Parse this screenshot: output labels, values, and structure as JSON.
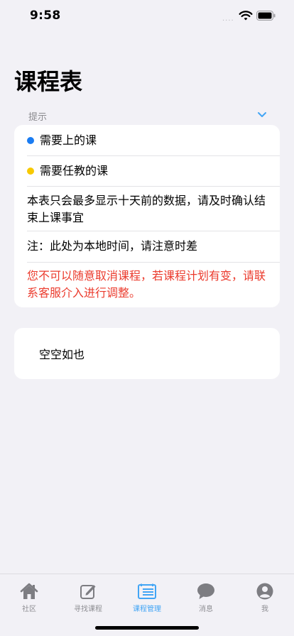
{
  "status_bar": {
    "time": "9:58",
    "signal": "...."
  },
  "page": {
    "title": "课程表"
  },
  "tips": {
    "header": "提示",
    "items": [
      {
        "text": "需要上的课",
        "dot_color": "#1a7cf2"
      },
      {
        "text": "需要任教的课",
        "dot_color": "#f7c900"
      },
      {
        "text": "本表只会最多显示十天前的数据，请及时确认结束上课事宜"
      },
      {
        "text": "注：此处为本地时间，请注意时差"
      },
      {
        "text": "您不可以随意取消课程，若课程计划有变，请联系客服介入进行调整。",
        "color": "#eb3b2d"
      }
    ]
  },
  "empty": {
    "text": "空空如也"
  },
  "tabs": [
    {
      "label": "社区",
      "icon": "home-icon"
    },
    {
      "label": "寻找课程",
      "icon": "edit-icon"
    },
    {
      "label": "课程管理",
      "icon": "schedule-icon",
      "active": true
    },
    {
      "label": "消息",
      "icon": "chat-icon"
    },
    {
      "label": "我",
      "icon": "profile-icon"
    }
  ],
  "colors": {
    "accent": "#42a5f5",
    "warning": "#eb3b2d",
    "background": "#f2f1f6"
  }
}
